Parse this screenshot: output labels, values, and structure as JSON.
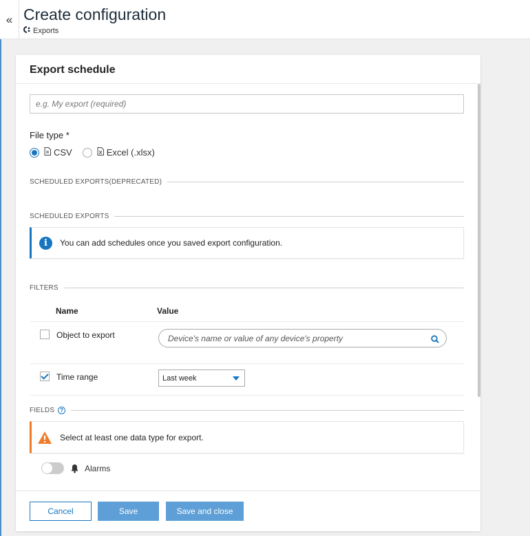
{
  "header": {
    "collapse_label": "«",
    "title": "Create configuration",
    "breadcrumb_icon": "C",
    "breadcrumb": "Exports"
  },
  "modal": {
    "title": "Export schedule",
    "name_placeholder": "e.g. My export (required)",
    "file_type_label": "File type *",
    "file_types": [
      {
        "label": "CSV",
        "icon": "file-csv-icon",
        "selected": true
      },
      {
        "label": "Excel (.xlsx)",
        "icon": "file-excel-icon",
        "selected": false
      }
    ],
    "sections": {
      "deprecated": "SCHEDULED EXPORTS(DEPRECATED)",
      "scheduled": "SCHEDULED EXPORTS",
      "filters": "FILTERS",
      "fields": "FIELDS"
    },
    "info_message": "You can add schedules once you saved export configuration.",
    "filters_table": {
      "columns": [
        "Name",
        "Value"
      ],
      "rows": [
        {
          "label": "Object to export",
          "checked": false,
          "placeholder": "Device's name or value of any device's property"
        },
        {
          "label": "Time range",
          "checked": true,
          "value": "Last week"
        }
      ]
    },
    "warning_message": "Select at least one data type for export.",
    "fields": [
      {
        "label": "Alarms",
        "icon": "bell-icon",
        "enabled": false
      }
    ]
  },
  "footer": {
    "cancel_label": "Cancel",
    "save_label": "Save",
    "save_close_label": "Save and close"
  },
  "colors": {
    "accent": "#1776bf",
    "warning": "#f07c2a",
    "primary_button": "#5d9fd6"
  }
}
